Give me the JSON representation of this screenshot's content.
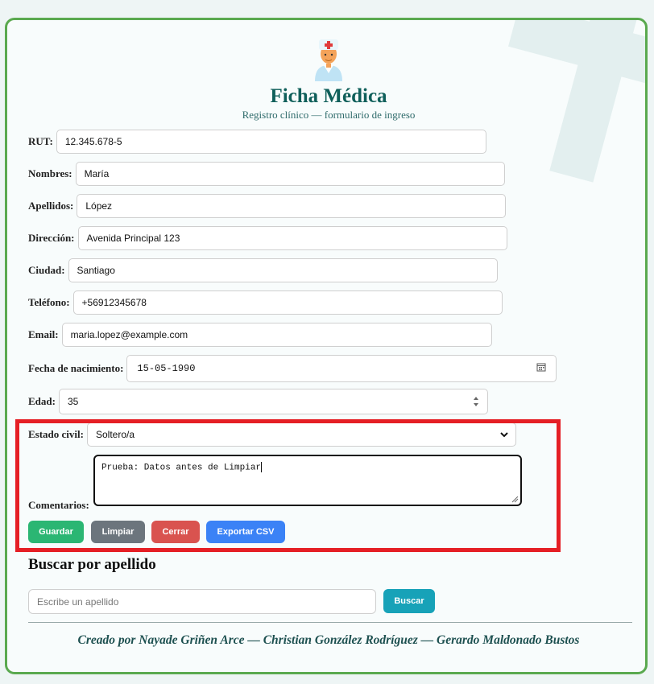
{
  "header": {
    "title": "Ficha Médica",
    "subtitle": "Registro clínico — formulario de ingreso"
  },
  "form": {
    "rut": {
      "label": "RUT:",
      "value": "12.345.678-5"
    },
    "nombres": {
      "label": "Nombres:",
      "value": "María"
    },
    "apellidos": {
      "label": "Apellidos:",
      "value": "López"
    },
    "direccion": {
      "label": "Dirección:",
      "value": "Avenida Principal 123"
    },
    "ciudad": {
      "label": "Ciudad:",
      "value": "Santiago"
    },
    "telefono": {
      "label": "Teléfono:",
      "value": "+56912345678"
    },
    "email": {
      "label": "Email:",
      "value": "maria.lopez@example.com"
    },
    "fecha": {
      "label": "Fecha de nacimiento:",
      "value": "15-05-1990"
    },
    "edad": {
      "label": "Edad:",
      "value": "35"
    },
    "estado_civil": {
      "label": "Estado civil:",
      "value": "Soltero/a"
    },
    "comentarios": {
      "label": "Comentarios:",
      "value": "Prueba: Datos antes de Limpiar"
    }
  },
  "buttons": {
    "guardar": "Guardar",
    "limpiar": "Limpiar",
    "cerrar": "Cerrar",
    "exportar": "Exportar CSV",
    "buscar": "Buscar"
  },
  "search": {
    "title": "Buscar por apellido",
    "placeholder": "Escribe un apellido"
  },
  "footer": {
    "credits": "Creado por Nayade Griñen Arce — Christian González Rodríguez — Gerardo Maldonado Bustos"
  },
  "colors": {
    "accent_green": "#2bb673",
    "gray": "#6c757d",
    "red": "#d9534f",
    "blue": "#3b82f6",
    "teal": "#17a2b8",
    "border_green": "#5aa94f",
    "highlight_red": "#e51f25"
  },
  "icons": {
    "doctor": "doctor-icon",
    "calendar": "calendar-icon",
    "spinner": "number-spinner-icon",
    "chevron": "chevron-down-icon"
  }
}
